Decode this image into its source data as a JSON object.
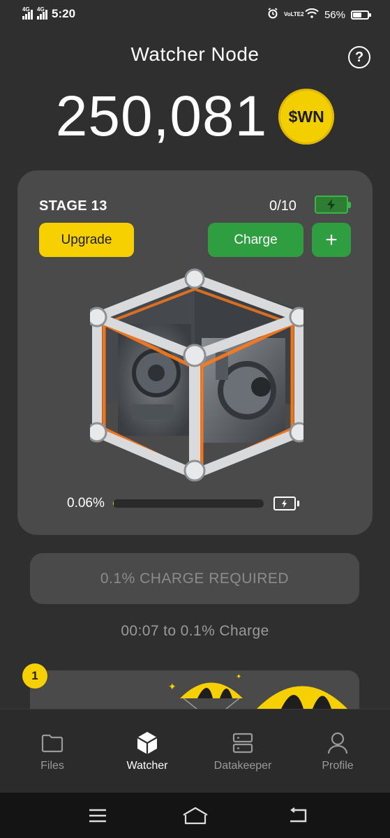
{
  "status_bar": {
    "network_1": "4G",
    "network_2": "4G",
    "time": "5:20",
    "volte": "VoLTE2",
    "battery_percent": "56%",
    "battery_level": 0.56
  },
  "header": {
    "title": "Watcher Node",
    "help_label": "?"
  },
  "balance": {
    "amount": "250,081",
    "currency": "$WN"
  },
  "node_card": {
    "stage": "STAGE 13",
    "charges": "0/10",
    "upgrade_label": "Upgrade",
    "charge_label": "Charge",
    "plus_label": "+",
    "progress_text": "0.06%",
    "progress_fraction": 0.0006
  },
  "charge_required": "0.1% CHARGE REQUIRED",
  "timer_text": "00:07  to 0.1% Charge",
  "promo": {
    "badge": "1"
  },
  "nav": {
    "items": [
      {
        "label": "Files",
        "icon": "folder-icon"
      },
      {
        "label": "Watcher",
        "icon": "cube-icon"
      },
      {
        "label": "Datakeeper",
        "icon": "server-icon"
      },
      {
        "label": "Profile",
        "icon": "user-icon"
      }
    ],
    "active": "Watcher"
  },
  "colors": {
    "background": "#2f2f2f",
    "card": "#4a4a4a",
    "accent_yellow": "#f6d000",
    "accent_green": "#2e9e41"
  }
}
